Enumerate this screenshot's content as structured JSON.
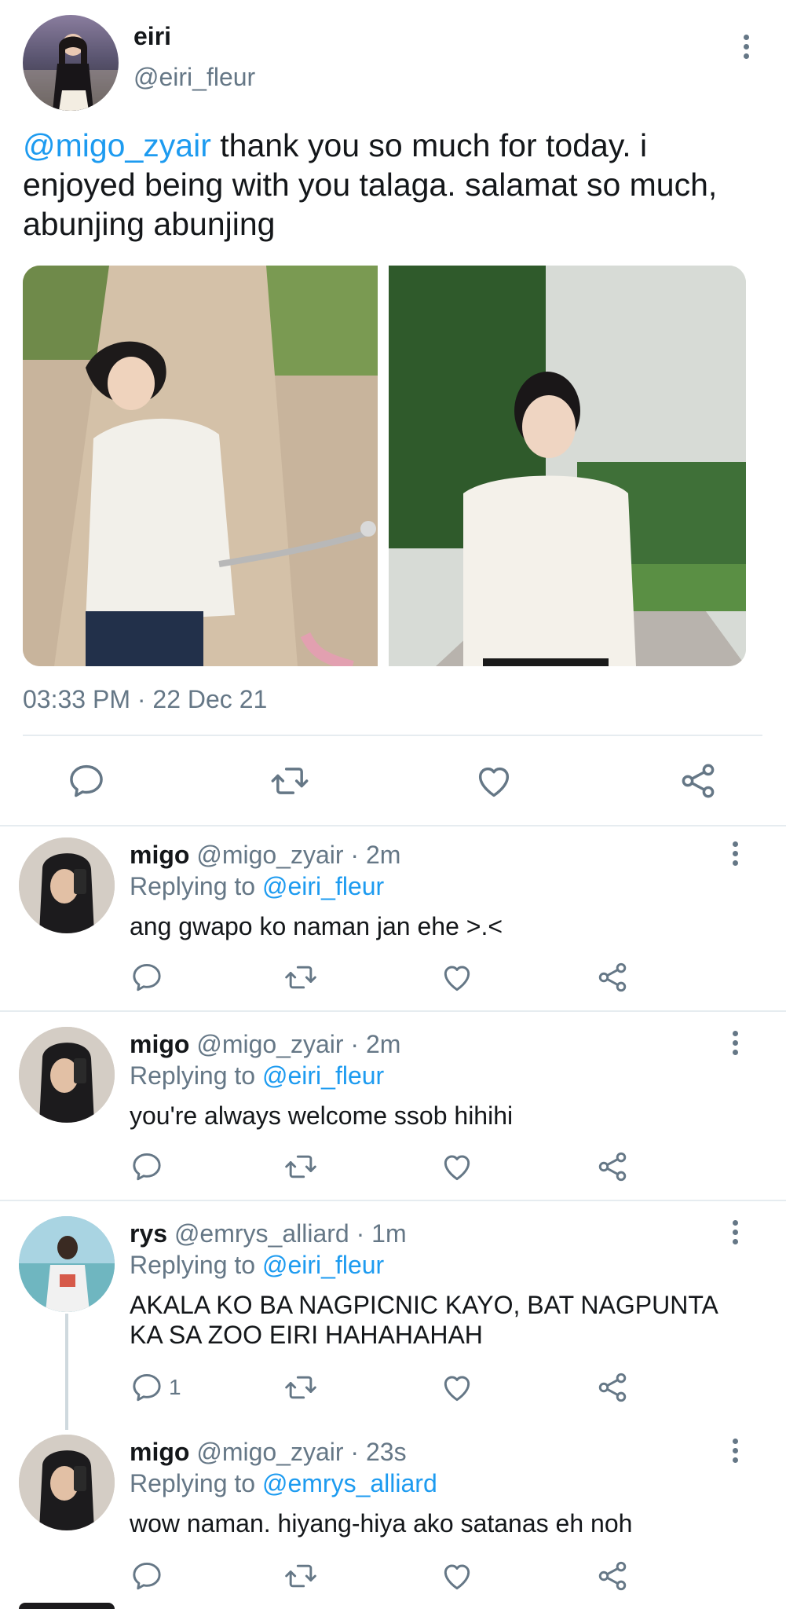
{
  "main_tweet": {
    "display_name": "eiri",
    "handle": "@eiri_fleur",
    "mention": "@migo_zyair",
    "text": " thank you so much for today. i enjoyed being with you talaga. salamat so much, abunjing abunjing",
    "timestamp": "03:33 PM · 22 Dec 21",
    "images": [
      "photo-riding-bicycle",
      "photo-on-road"
    ]
  },
  "replies": [
    {
      "display_name": "migo",
      "meta": "@migo_zyair · 2m",
      "replying_label": "Replying to ",
      "replying_handle": "@eiri_fleur",
      "text": "ang gwapo ko naman jan ehe >.<",
      "reply_count": ""
    },
    {
      "display_name": "migo",
      "meta": "@migo_zyair · 2m",
      "replying_label": "Replying to ",
      "replying_handle": "@eiri_fleur",
      "text": "you're always welcome ssob hihihi",
      "reply_count": ""
    },
    {
      "display_name": "rys",
      "meta": "@emrys_alliard · 1m",
      "replying_label": "Replying to ",
      "replying_handle": "@eiri_fleur",
      "text": "AKALA KO BA NAGPICNIC KAYO, BAT NAGPUNTA KA SA ZOO EIRI HAHAHAHAH",
      "reply_count": "1"
    },
    {
      "display_name": "migo",
      "meta": "@migo_zyair · 23s",
      "replying_label": "Replying to ",
      "replying_handle": "@emrys_alliard",
      "text": "wow naman. hiyang-hiya ako satanas eh noh",
      "reply_count": ""
    }
  ],
  "colors": {
    "link": "#1d9bf0",
    "muted": "#657786",
    "divider": "#e6ecf0"
  },
  "icons": [
    "more-vertical-icon",
    "reply-icon",
    "retweet-icon",
    "like-icon",
    "share-icon"
  ]
}
